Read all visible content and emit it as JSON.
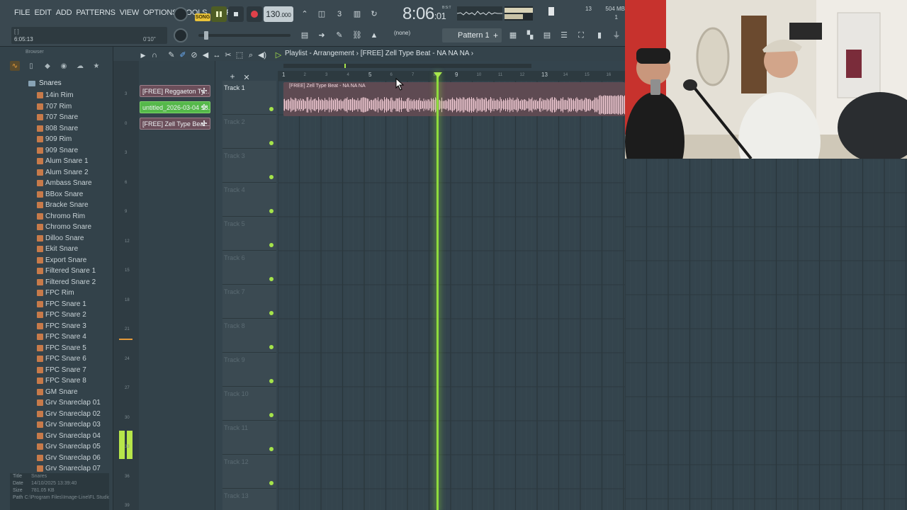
{
  "menu": [
    "FILE",
    "EDIT",
    "ADD",
    "PATTERNS",
    "VIEW",
    "OPTIONS",
    "TOOLS",
    "HELP"
  ],
  "hint": {
    "brackets": "[ ]",
    "time": "6:05:13",
    "small": "0'10\""
  },
  "transport": {
    "song_label": "SONG",
    "bpm": "130",
    "bpm_decimal": ".000"
  },
  "clock": {
    "time": "8:06",
    "ms": ":01",
    "bst": "B:S:T"
  },
  "monitor": {
    "mem_num": "13",
    "mem_mb": "504 MB",
    "mem_one": "1",
    "cpu_fill": 1.0,
    "mem_fill": 0.65
  },
  "pattern": {
    "snap": "(none)",
    "name": "Pattern 1"
  },
  "browser": {
    "header": "Browser",
    "folder": "Snares",
    "files": [
      "14in Rim",
      "707 Rim",
      "707 Snare",
      "808 Snare",
      "909 Rim",
      "909 Snare",
      "Alum Snare 1",
      "Alum Snare 2",
      "Ambass Snare",
      "BBox Snare",
      "Bracke Snare",
      "Chromo Rim",
      "Chromo Snare",
      "Dilloo Snare",
      "Ekit Snare",
      "Export Snare",
      "Filtered Snare 1",
      "Filtered Snare 2",
      "FPC Rim",
      "FPC Snare 1",
      "FPC Snare 2",
      "FPC Snare 3",
      "FPC Snare 4",
      "FPC Snare 5",
      "FPC Snare 6",
      "FPC Snare 7",
      "FPC Snare 8",
      "GM Snare",
      "Grv Snareclap 01",
      "Grv Snareclap 02",
      "Grv Snareclap 03",
      "Grv Snareclap 04",
      "Grv Snareclap 05",
      "Grv Snareclap 06",
      "Grv Snareclap 07"
    ],
    "info": [
      {
        "k": "Title",
        "v": "Snares"
      },
      {
        "k": "Date",
        "v": "14/10/2025 13:39:40"
      },
      {
        "k": "Size",
        "v": "781.05 KB"
      },
      {
        "k": "Path",
        "v": "C:\\Program Files\\Image-Line\\FL Studio 2024\\Data\\Patche..."
      }
    ]
  },
  "meter_labels": [
    "3",
    "0",
    "3",
    "6",
    "9",
    "12",
    "15",
    "18",
    "21",
    "24",
    "27",
    "30",
    "33",
    "36",
    "39"
  ],
  "clips": [
    {
      "label": "[FREE] Reggaeton Ty...",
      "color": "#6b4e5a"
    },
    {
      "label": "untitled_2026-03-04 18...",
      "color": "#55b84a"
    },
    {
      "label": "[FREE] Zell Type Beat...",
      "color": "#6b4e5a"
    }
  ],
  "playlist": {
    "breadcrumb": "Playlist - Arrangement › [FREE] Zell Type Beat - NA NA NA ›",
    "clip_title": "[FREE] Zell Type Beat - NA NA NA",
    "tracks": [
      "Track 1",
      "Track 2",
      "Track 3",
      "Track 4",
      "Track 5",
      "Track 6",
      "Track 7",
      "Track 8",
      "Track 9",
      "Track 10",
      "Track 11",
      "Track 12",
      "Track 13"
    ],
    "bars": [
      "1",
      "2",
      "3",
      "4",
      "5",
      "6",
      "7",
      "8",
      "9",
      "10",
      "11",
      "12",
      "13",
      "14",
      "15",
      "16"
    ],
    "playhead_bar": 8.25
  }
}
